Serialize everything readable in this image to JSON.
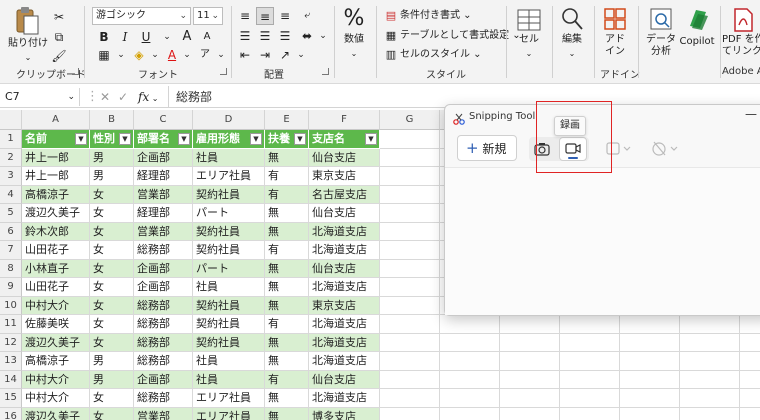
{
  "ribbon": {
    "clipboard": {
      "paste_label": "貼り付け",
      "group_label": "クリップボード"
    },
    "font": {
      "font_name": "游ゴシック",
      "font_size": "11",
      "grow_label": "A",
      "shrink_label": "A",
      "bold": "B",
      "italic": "I",
      "underline": "U",
      "phonetic_label": "ア",
      "font_color_label": "A",
      "group_label": "フォント"
    },
    "alignment": {
      "group_label": "配置"
    },
    "number": {
      "symbol": "%",
      "label": "数値"
    },
    "styles": {
      "conditional": "条件付き書式",
      "as_table": "テーブルとして書式設定",
      "cell_styles": "セルのスタイル",
      "group_label": "スタイル"
    },
    "cells": {
      "label": "セル"
    },
    "editing": {
      "label": "編集"
    },
    "addins": {
      "addin_label_1": "アド",
      "addin_label_2": "イン",
      "group_label": "アドイン"
    },
    "data_analysis": {
      "label_1": "データ",
      "label_2": "分析"
    },
    "copilot": {
      "label": "Copilot"
    },
    "adobe": {
      "label_1": "PDF を作",
      "label_2": "てリンクを",
      "group_label": "Adobe Acrobat"
    }
  },
  "formula_bar": {
    "name_box": "C7",
    "fx": "fx",
    "value": "総務部"
  },
  "columns": [
    "A",
    "B",
    "C",
    "D",
    "E",
    "F",
    "G",
    "H"
  ],
  "table": {
    "headers": [
      "名前",
      "性別",
      "部署名",
      "雇用形態",
      "扶養",
      "支店名"
    ],
    "rows": [
      [
        "井上一郎",
        "男",
        "企画部",
        "社員",
        "無",
        "仙台支店"
      ],
      [
        "井上一郎",
        "男",
        "経理部",
        "エリア社員",
        "有",
        "東京支店"
      ],
      [
        "高橋涼子",
        "女",
        "営業部",
        "契約社員",
        "有",
        "名古屋支店"
      ],
      [
        "渡辺久美子",
        "女",
        "経理部",
        "パート",
        "無",
        "仙台支店"
      ],
      [
        "鈴木次郎",
        "女",
        "営業部",
        "契約社員",
        "無",
        "北海道支店"
      ],
      [
        "山田花子",
        "女",
        "総務部",
        "契約社員",
        "有",
        "北海道支店"
      ],
      [
        "小林直子",
        "女",
        "企画部",
        "パート",
        "無",
        "仙台支店"
      ],
      [
        "山田花子",
        "女",
        "企画部",
        "社員",
        "無",
        "北海道支店"
      ],
      [
        "中村大介",
        "女",
        "総務部",
        "契約社員",
        "無",
        "東京支店"
      ],
      [
        "佐藤美咲",
        "女",
        "総務部",
        "契約社員",
        "有",
        "北海道支店"
      ],
      [
        "渡辺久美子",
        "女",
        "総務部",
        "契約社員",
        "無",
        "北海道支店"
      ],
      [
        "高橋涼子",
        "男",
        "総務部",
        "社員",
        "無",
        "北海道支店"
      ],
      [
        "中村大介",
        "男",
        "企画部",
        "社員",
        "有",
        "仙台支店"
      ],
      [
        "中村大介",
        "女",
        "総務部",
        "エリア社員",
        "無",
        "北海道支店"
      ],
      [
        "渡辺久美子",
        "女",
        "営業部",
        "エリア社員",
        "無",
        "博多支店"
      ]
    ]
  },
  "row_numbers": [
    "1",
    "2",
    "3",
    "4",
    "5",
    "6",
    "7",
    "8",
    "9",
    "10",
    "11",
    "12",
    "13",
    "14",
    "15",
    "16"
  ],
  "snipping_tool": {
    "title": "Snipping Tool",
    "new_button": "新規",
    "tooltip": "録画",
    "mode": "video",
    "accent": "#2f5fb3"
  },
  "colors": {
    "table_header": "#5db84b",
    "band": "#d9efd1",
    "highlight": "#e02424"
  }
}
